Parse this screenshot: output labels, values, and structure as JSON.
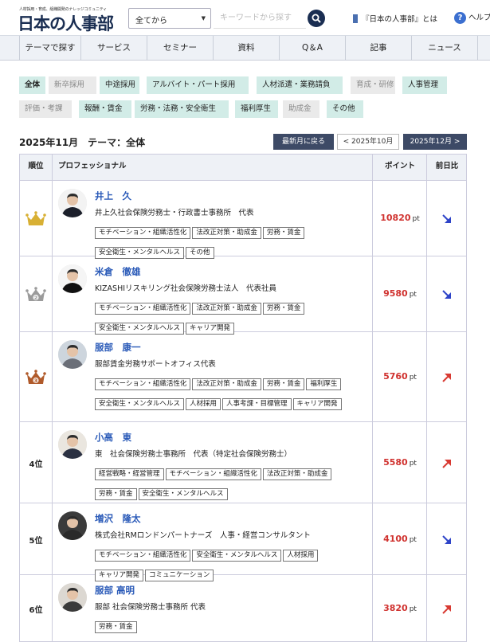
{
  "header": {
    "tagline": "人材採用・育成、組織開発のナレッジコミュニティ",
    "logo": "日本の人事部",
    "select_value": "全てから",
    "search_placeholder": "キーワードから探す",
    "about_link": "『日本の人事部』とは",
    "help_link": "ヘルプ"
  },
  "nav": [
    "テーマで探す",
    "サービス",
    "セミナー",
    "資料",
    "Q＆A",
    "記事",
    "ニュース"
  ],
  "filters": [
    {
      "label": "全体",
      "state": "sel"
    },
    {
      "label": "新卒採用",
      "state": "off"
    },
    {
      "label": "中途採用",
      "state": "on"
    },
    {
      "label": "アルバイト・パート採用",
      "state": "on"
    },
    {
      "label": "人材派遣・業務請負",
      "state": "on"
    },
    {
      "label": "育成・研修",
      "state": "off"
    },
    {
      "label": "人事管理",
      "state": "on"
    },
    {
      "label": "評価・考課",
      "state": "off"
    },
    {
      "label": "報酬・賃金",
      "state": "on"
    },
    {
      "label": "労務・法務・安全衛生",
      "state": "on"
    },
    {
      "label": "福利厚生",
      "state": "on"
    },
    {
      "label": "助成金",
      "state": "off"
    },
    {
      "label": "その他",
      "state": "on"
    }
  ],
  "title": "2025年11月　テーマ：全体",
  "buttons": {
    "latest": "最新月に戻る",
    "prev": "< 2025年10月",
    "next": "2025年12月 >"
  },
  "table_headers": {
    "rank": "順位",
    "pro": "プロフェッショナル",
    "points": "ポイント",
    "diff": "前日比"
  },
  "point_unit": "pt",
  "rows": [
    {
      "rank": "1",
      "medal": "gold",
      "name": "井上　久",
      "org": "井上久社会保険労務士・行政書士事務所　代表",
      "tags": [
        "モチベーション・組織活性化",
        "法改正対策・助成金",
        "労務・賃金",
        "安全衛生・メンタルヘルス",
        "その他"
      ],
      "points": "10820",
      "trend": "down"
    },
    {
      "rank": "2",
      "medal": "silver",
      "name": "米倉　徹雄",
      "org": "KIZASHIリスキリング社会保険労務士法人　代表社員",
      "tags": [
        "モチベーション・組織活性化",
        "法改正対策・助成金",
        "労務・賃金",
        "安全衛生・メンタルヘルス",
        "キャリア開発"
      ],
      "points": "9580",
      "trend": "down"
    },
    {
      "rank": "3",
      "medal": "bronze",
      "name": "服部　康一",
      "org": "服部賃金労務サポートオフィス代表",
      "tags": [
        "モチベーション・組織活性化",
        "法改正対策・助成金",
        "労務・賃金",
        "福利厚生",
        "安全衛生・メンタルヘルス",
        "人材採用",
        "人事考課・目標管理",
        "キャリア開発"
      ],
      "points": "5760",
      "trend": "up"
    },
    {
      "rank": "4位",
      "medal": "",
      "name": "小高　東",
      "org": "東　社会保険労務士事務所　代表（特定社会保険労務士）",
      "tags": [
        "経営戦略・経営管理",
        "モチベーション・組織活性化",
        "法改正対策・助成金",
        "労務・賃金",
        "安全衛生・メンタルヘルス"
      ],
      "points": "5580",
      "trend": "up"
    },
    {
      "rank": "5位",
      "medal": "",
      "name": "増沢　隆太",
      "org": "株式会社RMロンドンパートナーズ　人事・経営コンサルタント",
      "tags": [
        "モチベーション・組織活性化",
        "安全衛生・メンタルヘルス",
        "人材採用",
        "キャリア開発",
        "コミュニケーション"
      ],
      "points": "4100",
      "trend": "down"
    },
    {
      "rank": "6位",
      "medal": "",
      "name": "服部 高明",
      "org": "服部 社会保険労務士事務所 代表",
      "tags": [
        "労務・賃金"
      ],
      "points": "3820",
      "trend": "up"
    }
  ]
}
